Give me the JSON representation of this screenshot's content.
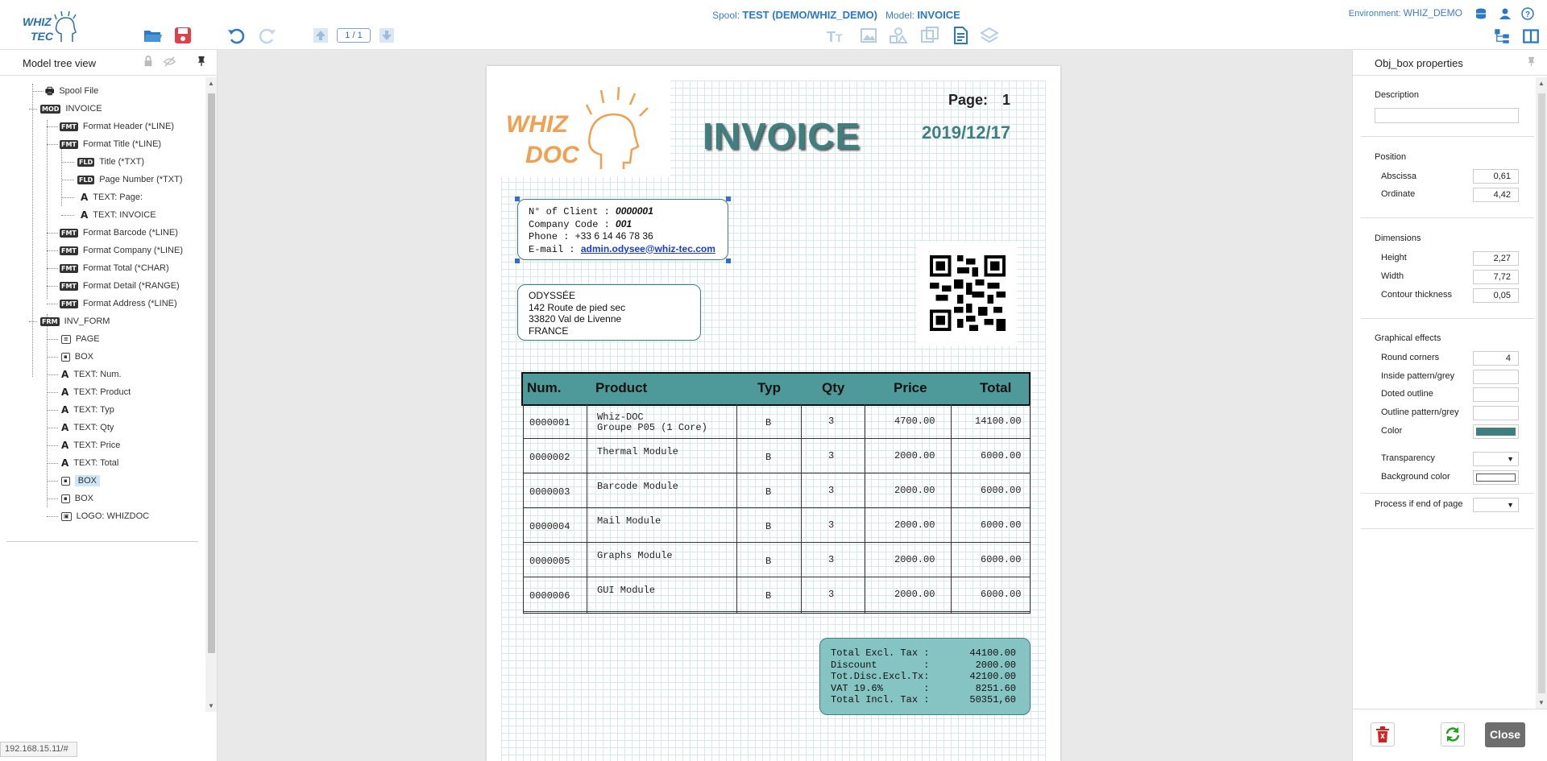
{
  "header": {
    "spool_label": "Spool:",
    "spool_value": "TEST (DEMO/WHIZ_DEMO)",
    "model_label": "Model:",
    "model_value": "INVOICE",
    "env_label": "Environment:",
    "env_value": "WHIZ_DEMO",
    "pager": "1 / 1",
    "logo_text_top": "WHIZ",
    "logo_text_bottom": "TEC"
  },
  "left_panel": {
    "title": "Model tree view",
    "tree": [
      {
        "label": "Spool File",
        "icon": "printer-icon"
      },
      {
        "label": "INVOICE",
        "icon": "model-icon"
      },
      {
        "label": "Format Header (*LINE)",
        "icon": "format-icon"
      },
      {
        "label": "Format Title (*LINE)",
        "icon": "format-icon"
      },
      {
        "label": "Title (*TXT)",
        "icon": "field-icon"
      },
      {
        "label": "Page Number (*TXT)",
        "icon": "field-icon"
      },
      {
        "label": "TEXT: Page:",
        "icon": "text-icon"
      },
      {
        "label": "TEXT: INVOICE",
        "icon": "text-icon"
      },
      {
        "label": "Format Barcode (*LINE)",
        "icon": "format-icon"
      },
      {
        "label": "Format Company (*LINE)",
        "icon": "format-icon"
      },
      {
        "label": "Format Total (*CHAR)",
        "icon": "format-icon"
      },
      {
        "label": "Format Detail (*RANGE)",
        "icon": "format-icon"
      },
      {
        "label": "Format Address (*LINE)",
        "icon": "format-icon"
      },
      {
        "label": "INV_FORM",
        "icon": "form-icon"
      },
      {
        "label": "PAGE",
        "icon": "page-icon"
      },
      {
        "label": "BOX",
        "icon": "box-icon"
      },
      {
        "label": "TEXT: Num.",
        "icon": "text-icon"
      },
      {
        "label": "TEXT: Product",
        "icon": "text-icon"
      },
      {
        "label": "TEXT: Typ",
        "icon": "text-icon"
      },
      {
        "label": "TEXT: Qty",
        "icon": "text-icon"
      },
      {
        "label": "TEXT: Price",
        "icon": "text-icon"
      },
      {
        "label": "TEXT: Total",
        "icon": "text-icon"
      },
      {
        "label": "BOX",
        "icon": "box-icon",
        "selected": true
      },
      {
        "label": "BOX",
        "icon": "box-icon"
      },
      {
        "label": "LOGO: WHIZDOC",
        "icon": "logo-icon"
      }
    ],
    "status_url": "192.168.15.11/#"
  },
  "document": {
    "logo_top": "WHIZ",
    "logo_bottom": "DOC",
    "title": "INVOICE",
    "page_label": "Page:",
    "page_number": "1",
    "date": "2019/12/17",
    "client": {
      "client_label": "N° of Client  :",
      "client_value": "0000001",
      "company_label": "Company Code  :",
      "company_value": "001",
      "phone_label": "Phone  :",
      "phone_value": "+33 6 14 46 78 36",
      "email_label": "E-mail :",
      "email_value": "admin.odysee@whiz-tec.com"
    },
    "address": {
      "line1": "ODYSSÉE",
      "line2": "142 Route de pied sec",
      "line3": "33820 Val de Livenne",
      "line4": "FRANCE"
    },
    "table": {
      "headers": [
        "Num.",
        "Product",
        "Typ",
        "Qty",
        "Price",
        "Total"
      ],
      "rows": [
        {
          "num": "0000001",
          "product": "Whiz-DOC",
          "product2": "Groupe P05 (1 Core)",
          "typ": "B",
          "qty": "3",
          "price": "4700.00",
          "total": "14100.00"
        },
        {
          "num": "0000002",
          "product": "Thermal Module",
          "product2": "",
          "typ": "B",
          "qty": "3",
          "price": "2000.00",
          "total": "6000.00"
        },
        {
          "num": "0000003",
          "product": "Barcode Module",
          "product2": "",
          "typ": "B",
          "qty": "3",
          "price": "2000.00",
          "total": "6000.00"
        },
        {
          "num": "0000004",
          "product": "Mail Module",
          "product2": "",
          "typ": "B",
          "qty": "3",
          "price": "2000.00",
          "total": "6000.00"
        },
        {
          "num": "0000005",
          "product": "Graphs Module",
          "product2": "",
          "typ": "B",
          "qty": "3",
          "price": "2000.00",
          "total": "6000.00"
        },
        {
          "num": "0000006",
          "product": "GUI Module",
          "product2": "",
          "typ": "B",
          "qty": "3",
          "price": "2000.00",
          "total": "6000.00"
        }
      ]
    },
    "totals": [
      {
        "label": "Total Excl. Tax :",
        "value": "44100.00"
      },
      {
        "label": "Discount        :",
        "value": "2000.00"
      },
      {
        "label": "Tot.Disc.Excl.Tx:",
        "value": "42100.00"
      },
      {
        "label": "VAT 19.6%       :",
        "value": "8251.60"
      },
      {
        "label": "Total Incl. Tax :",
        "value": "50351,60"
      }
    ]
  },
  "right_panel": {
    "title": "Obj_box properties",
    "description_label": "Description",
    "description_value": "",
    "position_title": "Position",
    "abscissa_label": "Abscissa",
    "abscissa_value": "0,61",
    "ordinate_label": "Ordinate",
    "ordinate_value": "4,42",
    "dimensions_title": "Dimensions",
    "height_label": "Height",
    "height_value": "2,27",
    "width_label": "Width",
    "width_value": "7,72",
    "contour_label": "Contour thickness",
    "contour_value": "0,05",
    "effects_title": "Graphical effects",
    "round_label": "Round corners",
    "round_value": "4",
    "inside_pattern_label": "Inside pattern/grey",
    "doted_label": "Doted outline",
    "outline_pattern_label": "Outline pattern/grey",
    "color_label": "Color",
    "color_value": "#3f7f80",
    "transparency_label": "Transparency",
    "bg_color_label": "Background color",
    "bg_color_value": "#ffffff",
    "process_label": "Process if end of page",
    "close_label": "Close"
  },
  "colors": {
    "accent": "#3c7fc0",
    "teal": "#3f7f80",
    "header_teal": "#4e9a9a",
    "totals_teal": "#86c3c3",
    "logo_orange": "#f0a050"
  }
}
